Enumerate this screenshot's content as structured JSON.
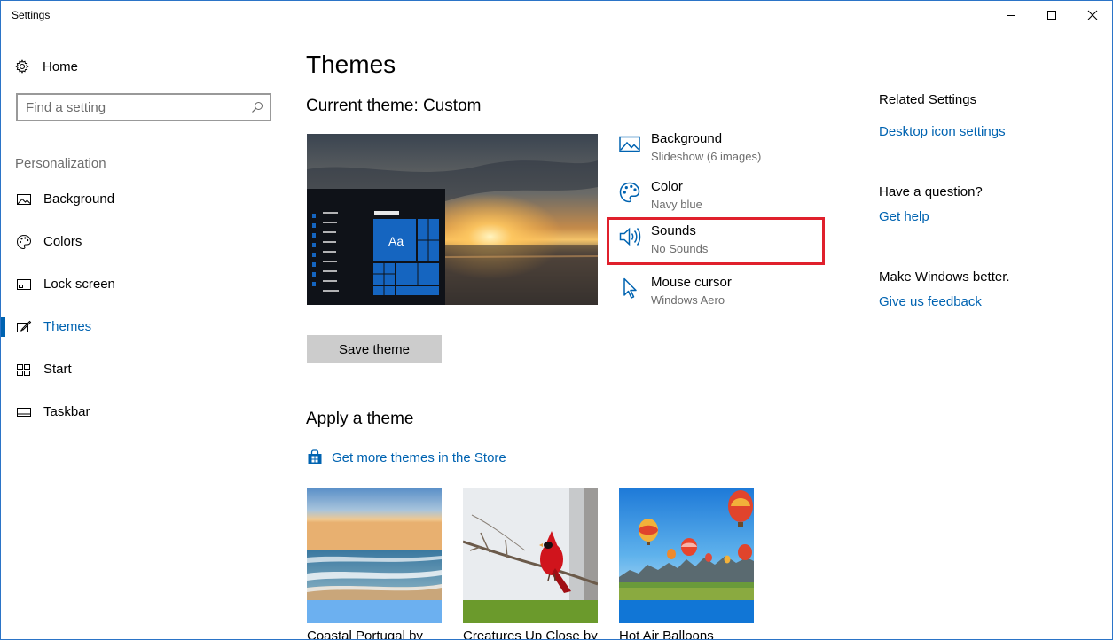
{
  "window": {
    "title": "Settings"
  },
  "sidebar": {
    "home_label": "Home",
    "search_placeholder": "Find a setting",
    "section_label": "Personalization",
    "items": [
      {
        "label": "Background",
        "icon": "picture-icon",
        "selected": false
      },
      {
        "label": "Colors",
        "icon": "palette-icon",
        "selected": false
      },
      {
        "label": "Lock screen",
        "icon": "lock-screen-icon",
        "selected": false
      },
      {
        "label": "Themes",
        "icon": "themes-brush-icon",
        "selected": true
      },
      {
        "label": "Start",
        "icon": "start-icon",
        "selected": false
      },
      {
        "label": "Taskbar",
        "icon": "taskbar-icon",
        "selected": false
      }
    ]
  },
  "main": {
    "title": "Themes",
    "current_theme_label": "Current theme: Custom",
    "preview_tile_text": "Aa",
    "properties": [
      {
        "name": "Background",
        "value": "Slideshow (6 images)",
        "icon": "picture-icon"
      },
      {
        "name": "Color",
        "value": "Navy blue",
        "icon": "palette-icon"
      },
      {
        "name": "Sounds",
        "value": "No Sounds",
        "icon": "speaker-icon",
        "highlighted": true
      },
      {
        "name": "Mouse cursor",
        "value": "Windows Aero",
        "icon": "cursor-icon"
      }
    ],
    "save_button": "Save theme",
    "apply_title": "Apply a theme",
    "store_link": "Get more themes in the Store",
    "themes": [
      {
        "name": "Coastal Portugal by",
        "accent": "#6cb0f0"
      },
      {
        "name": "Creatures Up Close by",
        "accent": "#6b9a2c"
      },
      {
        "name": "Hot Air Balloons",
        "accent": "#1176d6"
      }
    ]
  },
  "related": {
    "heading": "Related Settings",
    "desktop_icons_link": "Desktop icon settings",
    "question_heading": "Have a question?",
    "help_link": "Get help",
    "better_heading": "Make Windows better.",
    "feedback_link": "Give us feedback"
  },
  "colors": {
    "accent": "#0063b1",
    "highlight_border": "#e0202c"
  }
}
